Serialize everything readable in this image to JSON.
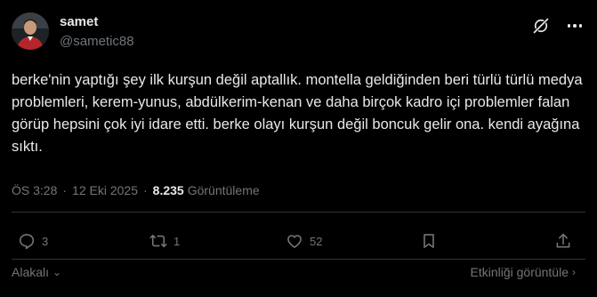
{
  "author": {
    "name": "samet",
    "handle": "@sametic88"
  },
  "tweet": {
    "text": "berke'nin yaptığı şey ilk kurşun değil aptallık. montella geldiğinden beri türlü türlü medya problemleri, kerem-yunus, abdülkerim-kenan ve daha birçok kadro içi problemler falan görüp hepsini çok iyi idare etti. berke olayı kurşun değil boncuk gelir ona. kendi ayağına sıktı.",
    "time": "ÖS 3:28",
    "separator": "·",
    "date": "12 Eki 2025",
    "views_count": "8.235",
    "views_label": "Görüntüleme"
  },
  "actions": {
    "reply": {
      "icon": "reply-icon",
      "count": "3"
    },
    "retweet": {
      "icon": "retweet-icon",
      "count": "1"
    },
    "like": {
      "icon": "heart-icon",
      "count": "52"
    },
    "bookmark": {
      "icon": "bookmark-icon"
    },
    "share": {
      "icon": "share-icon"
    }
  },
  "footer": {
    "related_label": "Alakalı",
    "activity_label": "Etkinliği görüntüle"
  },
  "colors": {
    "background": "#000000",
    "text": "#e7e9ea",
    "muted": "#71767b",
    "divider": "#2f3336"
  }
}
